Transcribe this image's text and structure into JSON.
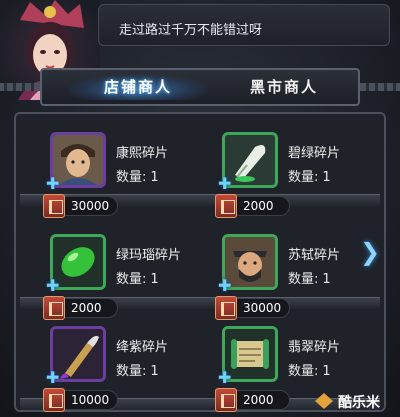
{
  "speech": {
    "text": "走过路过千万不能错过呀"
  },
  "tabs": {
    "shop": "店铺商人",
    "black": "黑市商人"
  },
  "qty_label": "数量:",
  "items": [
    {
      "name": "康熙碎片",
      "qty": "1",
      "price": "30000",
      "frame": "purple",
      "icon": "portrait-icon"
    },
    {
      "name": "碧绿碎片",
      "qty": "1",
      "price": "2000",
      "frame": "green",
      "icon": "quill-icon"
    },
    {
      "name": "绿玛瑙碎片",
      "qty": "1",
      "price": "2000",
      "frame": "green",
      "icon": "agate-icon"
    },
    {
      "name": "苏轼碎片",
      "qty": "1",
      "price": "30000",
      "frame": "green",
      "icon": "portrait-icon"
    },
    {
      "name": "绛紫碎片",
      "qty": "1",
      "price": "10000",
      "frame": "purple",
      "icon": "brush-icon"
    },
    {
      "name": "翡翠碎片",
      "qty": "1",
      "price": "2000",
      "frame": "green",
      "icon": "scroll-icon"
    }
  ],
  "watermark": "酷乐米"
}
